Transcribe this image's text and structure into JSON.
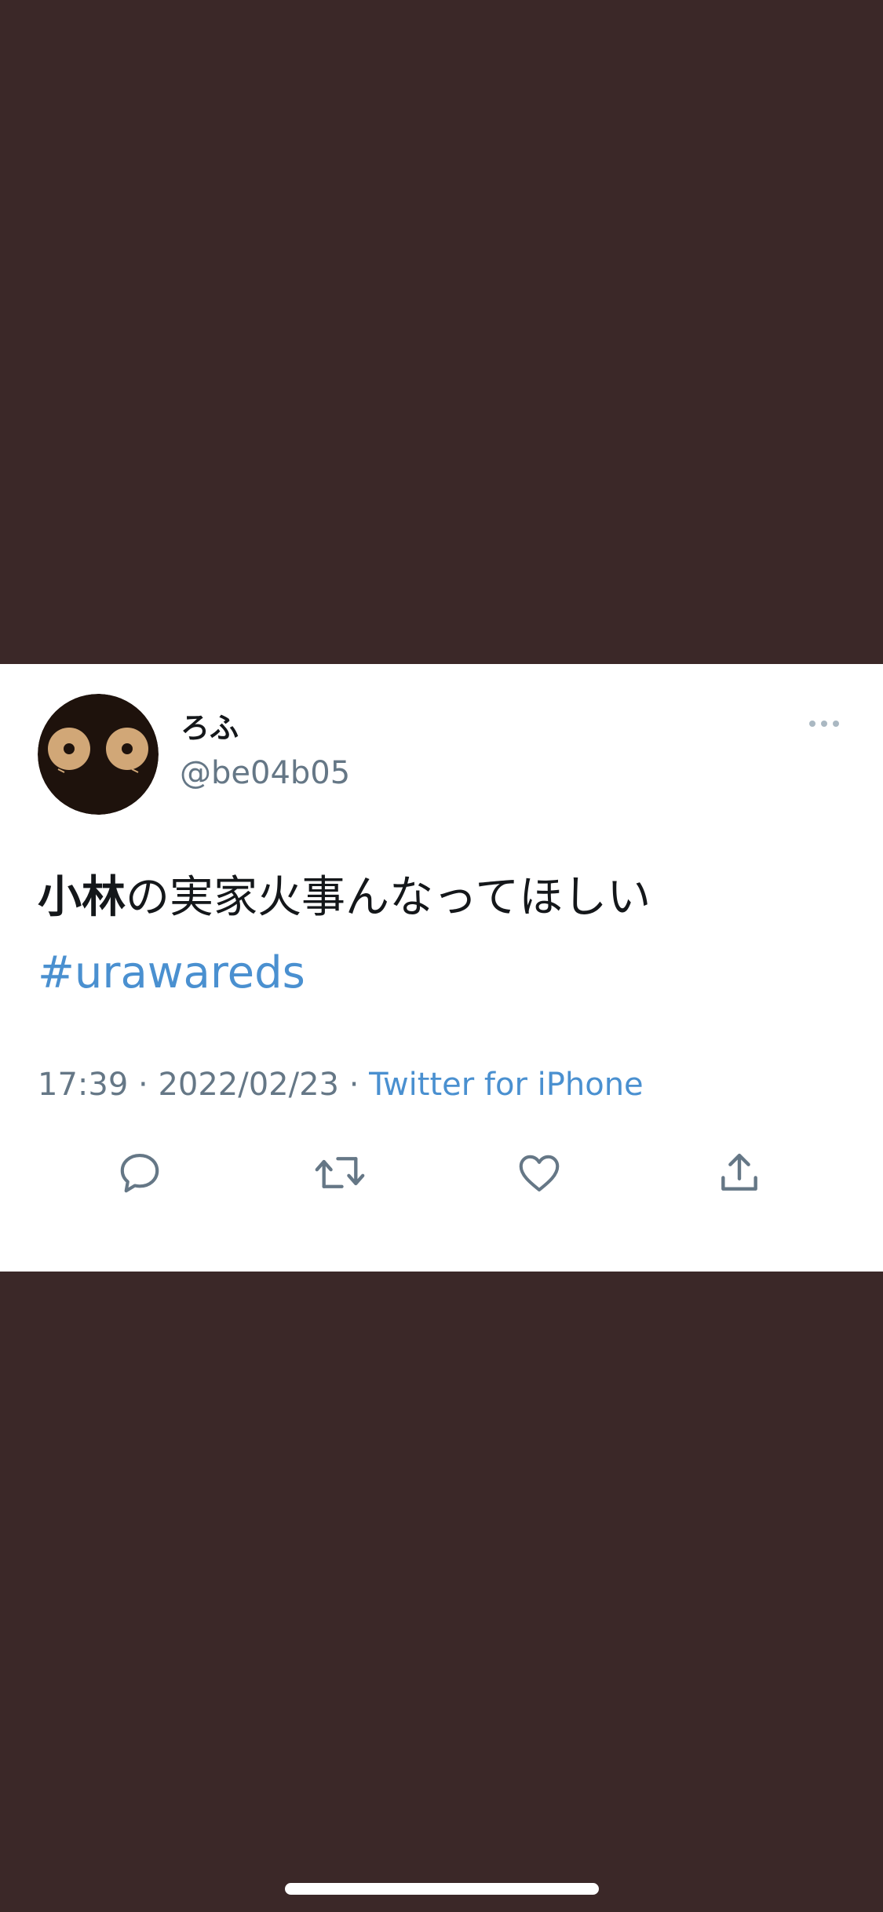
{
  "colors": {
    "background": "#3b2828",
    "card": "#ffffff",
    "text_primary": "#14171a",
    "text_secondary": "#657786",
    "link": "#4a90d0",
    "icon": "#657786",
    "more_dots": "#aab8c2",
    "home_indicator": "#ffffff",
    "avatar_bg": "#1e120c",
    "avatar_eye": "#d1a777"
  },
  "tweet": {
    "author": {
      "display_name": "ろふ",
      "handle": "@be04b05",
      "avatar_icon": "avatar-owl-eyes"
    },
    "more_icon": "more-horizontal-icon",
    "text": {
      "bold_part": "小林",
      "rest": "の実家火事んなってほしい",
      "hashtag": "#urawareds"
    },
    "meta": {
      "time": "17:39",
      "separator": " · ",
      "date": "2022/02/23",
      "source": "Twitter for iPhone"
    },
    "actions": [
      {
        "name": "reply",
        "icon": "reply-icon"
      },
      {
        "name": "retweet",
        "icon": "retweet-icon"
      },
      {
        "name": "like",
        "icon": "heart-icon"
      },
      {
        "name": "share",
        "icon": "share-icon"
      }
    ]
  }
}
